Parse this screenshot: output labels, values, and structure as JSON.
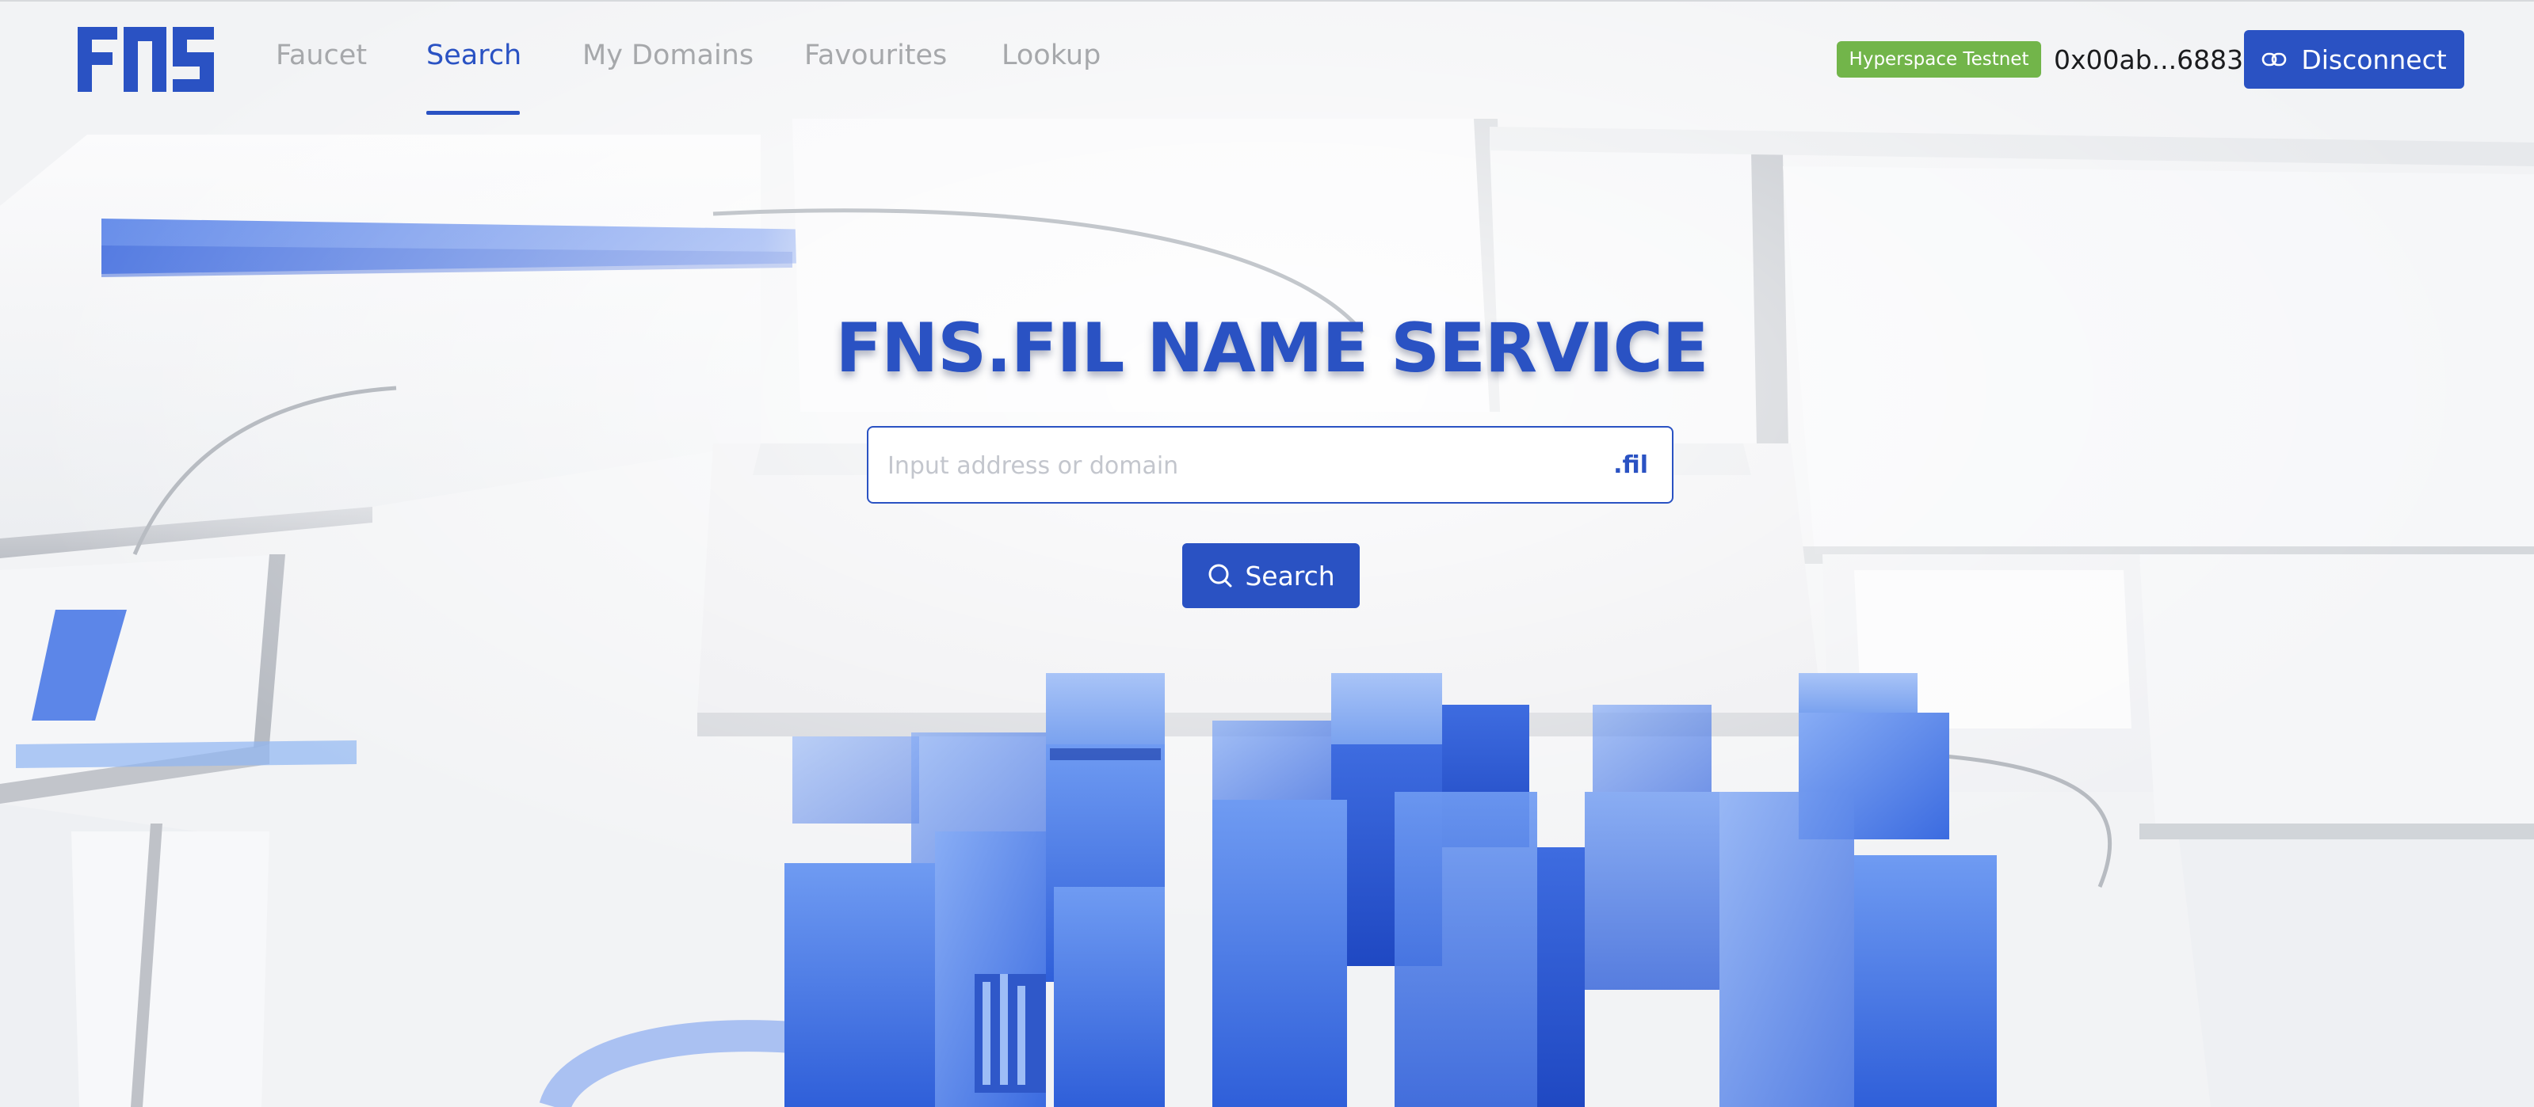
{
  "header": {
    "logo_text": "FNS",
    "nav": [
      {
        "label": "Faucet",
        "active": false
      },
      {
        "label": "Search",
        "active": true
      },
      {
        "label": "My Domains",
        "active": false
      },
      {
        "label": "Favourites",
        "active": false
      },
      {
        "label": "Lookup",
        "active": false
      }
    ],
    "network_badge": "Hyperspace Testnet",
    "wallet_address": "0x00ab...6883",
    "disconnect_label": "Disconnect",
    "disconnect_icon": "link-icon"
  },
  "hero": {
    "title": "FNS.FIL NAME SERVICE",
    "search_placeholder": "Input address or domain",
    "search_value": "",
    "tld_suffix": ".fil",
    "search_button_label": "Search",
    "search_button_icon": "search-icon"
  },
  "colors": {
    "brand_blue": "#2a52c3",
    "badge_green": "#72b54a",
    "nav_inactive": "#a6a8ab"
  }
}
